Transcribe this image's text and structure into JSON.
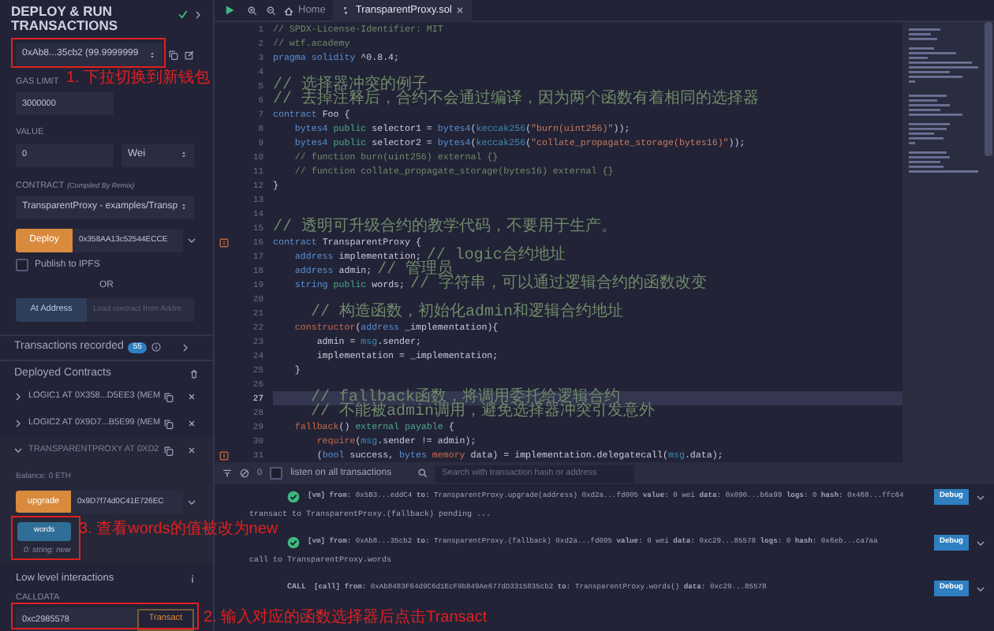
{
  "panel": {
    "title": "DEPLOY & RUN TRANSACTIONS",
    "account": "0xAb8...35cb2 (99.9999999",
    "gas_limit_label": "GAS LIMIT",
    "gas_limit": "3000000",
    "value_label": "VALUE",
    "value": "0",
    "unit": "Wei",
    "contract_label": "CONTRACT",
    "contract_note": "(Compiled By Remix)",
    "contract": "TransparentProxy - examples/Transp",
    "deploy_button": "Deploy",
    "deploy_args": "0x358AA13c52544ECCE",
    "publish": {
      "label": "Publish to IPFS",
      "checked": false
    },
    "or": "OR",
    "at_address_button": "At Address",
    "load_placeholder": "Load contract from Addre"
  },
  "transactions_recorded": {
    "label": "Transactions recorded",
    "count": "55"
  },
  "deployed": {
    "title": "Deployed Contracts",
    "contracts": [
      {
        "name": "LOGIC1 AT 0X358...D5EE3 (MEM",
        "expanded": false
      },
      {
        "name": "LOGIC2 AT 0X9D7...B5E99 (MEM",
        "expanded": false
      },
      {
        "name": "TRANSPARENTPROXY AT 0XD2",
        "expanded": true
      }
    ],
    "balance": "Balance: 0 ETH",
    "functions": [
      {
        "kind": "transact",
        "label": "upgrade",
        "input": "0x9D7f74d0C41E726EC"
      },
      {
        "kind": "call",
        "label": "words",
        "result": "0: string: new"
      }
    ],
    "low_level": {
      "title": "Low level interactions",
      "calldata_label": "CALLDATA",
      "calldata": "0xc2985578",
      "button": "Transact"
    }
  },
  "annotations": [
    {
      "text": "1. 下拉切换到新钱包"
    },
    {
      "text": "3. 查看words的值被改为new"
    },
    {
      "text": "2. 输入对应的函数选择器后点击Transact"
    }
  ],
  "editor": {
    "tabs": [
      {
        "label": "Home",
        "selected": false
      },
      {
        "label": "TransparentProxy.sol",
        "selected": true
      }
    ],
    "lines": [
      {
        "number": "1",
        "current": false,
        "marker": false,
        "segments": [
          {
            "text": "// SPDX-License-Identifier: MIT",
            "kind": "comment"
          }
        ]
      },
      {
        "number": "2",
        "current": false,
        "marker": false,
        "segments": [
          {
            "text": "// wtf.academy",
            "kind": "comment"
          }
        ]
      },
      {
        "number": "3",
        "current": false,
        "marker": false,
        "segments": [
          {
            "text": "pragma solidity",
            "kind": "keyword"
          },
          {
            "text": " ^0.8.4;",
            "kind": "plain"
          }
        ]
      },
      {
        "number": "4",
        "current": false,
        "marker": false
      },
      {
        "number": "5",
        "current": false,
        "marker": false,
        "segments": [
          {
            "text": "// 选择器冲突的例子",
            "kind": "comment"
          }
        ]
      },
      {
        "number": "6",
        "current": false,
        "marker": false,
        "segments": [
          {
            "text": "// 去掉注释后，合约不会通过编译，因为两个函数有着相同的选择器",
            "kind": "comment"
          }
        ]
      },
      {
        "number": "7",
        "current": false,
        "marker": false,
        "segments": [
          {
            "text": "contract",
            "kind": "keyword"
          },
          {
            "text": " Foo {",
            "kind": "plain"
          }
        ]
      },
      {
        "number": "8",
        "current": false,
        "marker": false,
        "segments": [
          {
            "text": "    bytes4 ",
            "kind": "type"
          },
          {
            "text": "public",
            "kind": "modifier"
          },
          {
            "text": " selector1 = ",
            "kind": "plain"
          },
          {
            "text": "bytes4",
            "kind": "type"
          },
          {
            "text": "(",
            "kind": "plain"
          },
          {
            "text": "keccak256",
            "kind": "builtin"
          },
          {
            "text": "(",
            "kind": "plain"
          },
          {
            "text": "\"burn(uint256)\"",
            "kind": "string"
          },
          {
            "text": "));",
            "kind": "plain"
          }
        ]
      },
      {
        "number": "9",
        "current": false,
        "marker": false,
        "segments": [
          {
            "text": "    bytes4 ",
            "kind": "type"
          },
          {
            "text": "public",
            "kind": "modifier"
          },
          {
            "text": " selector2 = ",
            "kind": "plain"
          },
          {
            "text": "bytes4",
            "kind": "type"
          },
          {
            "text": "(",
            "kind": "plain"
          },
          {
            "text": "keccak256",
            "kind": "builtin"
          },
          {
            "text": "(",
            "kind": "plain"
          },
          {
            "text": "\"collate_propagate_storage(bytes16)\"",
            "kind": "string"
          },
          {
            "text": "));",
            "kind": "plain"
          }
        ]
      },
      {
        "number": "10",
        "current": false,
        "marker": false,
        "segments": [
          {
            "text": "    // function burn(uint256) external {}",
            "kind": "comment"
          }
        ]
      },
      {
        "number": "11",
        "current": false,
        "marker": false,
        "segments": [
          {
            "text": "    // function collate_propagate_storage(bytes16) external {}",
            "kind": "comment"
          }
        ]
      },
      {
        "number": "12",
        "current": false,
        "marker": false,
        "segments": [
          {
            "text": "}",
            "kind": "plain"
          }
        ]
      },
      {
        "number": "13",
        "current": false,
        "marker": false
      },
      {
        "number": "14",
        "current": false,
        "marker": false
      },
      {
        "number": "15",
        "current": false,
        "marker": false,
        "segments": [
          {
            "text": "// 透明可升级合约的教学代码，不要用于生产。",
            "kind": "comment"
          }
        ]
      },
      {
        "number": "16",
        "current": false,
        "marker": true,
        "segments": [
          {
            "text": "contract",
            "kind": "keyword"
          },
          {
            "text": " TransparentProxy {",
            "kind": "plain"
          }
        ]
      },
      {
        "number": "17",
        "current": false,
        "marker": false,
        "segments": [
          {
            "text": "    address",
            "kind": "type"
          },
          {
            "text": " implementation; ",
            "kind": "plain"
          },
          {
            "text": "// logic合约地址",
            "kind": "comment"
          }
        ]
      },
      {
        "number": "18",
        "current": false,
        "marker": false,
        "segments": [
          {
            "text": "    address",
            "kind": "type"
          },
          {
            "text": " admin; ",
            "kind": "plain"
          },
          {
            "text": "// 管理员",
            "kind": "comment"
          }
        ]
      },
      {
        "number": "19",
        "current": false,
        "marker": false,
        "segments": [
          {
            "text": "    string ",
            "kind": "type"
          },
          {
            "text": "public",
            "kind": "modifier"
          },
          {
            "text": " words; ",
            "kind": "plain"
          },
          {
            "text": "// 字符串，可以通过逻辑合约的函数改变",
            "kind": "comment"
          }
        ]
      },
      {
        "number": "20",
        "current": false,
        "marker": false
      },
      {
        "number": "21",
        "current": false,
        "marker": false,
        "segments": [
          {
            "text": "    // 构造函数，初始化admin和逻辑合约地址",
            "kind": "comment"
          }
        ]
      },
      {
        "number": "22",
        "current": false,
        "marker": false,
        "segments": [
          {
            "text": "    constructor",
            "kind": "func"
          },
          {
            "text": "(",
            "kind": "plain"
          },
          {
            "text": "address",
            "kind": "type"
          },
          {
            "text": " _implementation){",
            "kind": "plain"
          }
        ]
      },
      {
        "number": "23",
        "current": false,
        "marker": false,
        "segments": [
          {
            "text": "        admin = ",
            "kind": "plain"
          },
          {
            "text": "msg",
            "kind": "builtin"
          },
          {
            "text": ".sender;",
            "kind": "plain"
          }
        ]
      },
      {
        "number": "24",
        "current": false,
        "marker": false,
        "segments": [
          {
            "text": "        implementation = _implementation;",
            "kind": "plain"
          }
        ]
      },
      {
        "number": "25",
        "current": false,
        "marker": false,
        "segments": [
          {
            "text": "    }",
            "kind": "plain"
          }
        ]
      },
      {
        "number": "26",
        "current": false,
        "marker": false
      },
      {
        "number": "27",
        "current": true,
        "marker": false,
        "segments": [
          {
            "text": "    // fallback函数，将调用委托给逻辑合约",
            "kind": "comment"
          }
        ]
      },
      {
        "number": "28",
        "current": false,
        "marker": false,
        "segments": [
          {
            "text": "    // 不能被admin调用，避免选择器冲突引发意外",
            "kind": "comment"
          }
        ]
      },
      {
        "number": "29",
        "current": false,
        "marker": false,
        "segments": [
          {
            "text": "    fallback",
            "kind": "func"
          },
          {
            "text": "() ",
            "kind": "plain"
          },
          {
            "text": "external payable",
            "kind": "modifier"
          },
          {
            "text": " {",
            "kind": "plain"
          }
        ]
      },
      {
        "number": "30",
        "current": false,
        "marker": false,
        "segments": [
          {
            "text": "        require",
            "kind": "func"
          },
          {
            "text": "(",
            "kind": "plain"
          },
          {
            "text": "msg",
            "kind": "builtin"
          },
          {
            "text": ".sender != admin);",
            "kind": "plain"
          }
        ]
      },
      {
        "number": "31",
        "current": false,
        "marker": true,
        "segments": [
          {
            "text": "        (",
            "kind": "plain"
          },
          {
            "text": "bool",
            "kind": "type"
          },
          {
            "text": " success, ",
            "kind": "plain"
          },
          {
            "text": "bytes ",
            "kind": "type"
          },
          {
            "text": "memory",
            "kind": "func"
          },
          {
            "text": " data) = implementation.delegatecall(",
            "kind": "plain"
          },
          {
            "text": "msg",
            "kind": "builtin"
          },
          {
            "text": ".data);",
            "kind": "plain"
          }
        ]
      }
    ]
  },
  "console": {
    "pending_count": "0",
    "listen": {
      "label": "listen on all transactions",
      "checked": false
    },
    "search_placeholder": "Search with transaction hash or address",
    "logs": [
      {
        "kind": "vm",
        "summary": "**[vm]** **from:** 0x5B3...eddC4 **to:** TransparentProxy.upgrade(address) 0xd2a...fd005 **value:** 0 wei **data:** 0x090...b6a99 **logs:** 0 **hash:** 0x468...ffc64",
        "detail": "transact to TransparentProxy.(fallback) pending ...",
        "debug": "Debug"
      },
      {
        "kind": "vm",
        "summary": "**[vm]** **from:** 0xAb8...35cb2 **to:** TransparentProxy.(fallback) 0xd2a...fd005 **value:** 0 wei **data:** 0xc29...85578 **logs:** 0 **hash:** 0x6eb...ca7aa",
        "detail": "call to TransparentProxy.words",
        "debug": "Debug"
      },
      {
        "kind": "call",
        "label": "CALL",
        "summary": "**[call]** **from:** 0xAb8483F64d9C6d1EcF9b849Ae677dD3315835cb2 **to:** TransparentProxy.words() **data:** 0xc29...85578",
        "debug": "Debug"
      }
    ]
  }
}
